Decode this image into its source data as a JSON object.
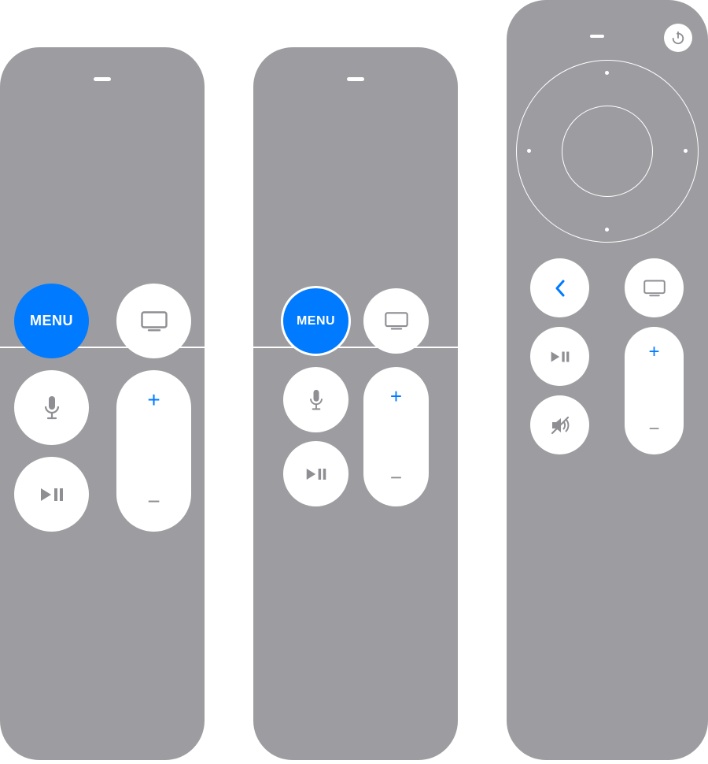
{
  "colors": {
    "accent": "#007aff",
    "remote_body": "#9d9da1",
    "button_face": "#ffffff",
    "icon_gray": "#8e8e93"
  },
  "remotes": [
    {
      "id": "siri-remote-gen1",
      "menu_label": "MENU",
      "menu_highlighted": true,
      "menu_style": "filled-blue",
      "buttons": [
        "menu",
        "tv",
        "mic",
        "play-pause",
        "volume-up",
        "volume-down"
      ],
      "touch_surface": "glass-top"
    },
    {
      "id": "siri-remote-gen1-alt",
      "menu_label": "MENU",
      "menu_highlighted": true,
      "menu_style": "blue-with-white-ring",
      "buttons": [
        "menu",
        "tv",
        "mic",
        "play-pause",
        "volume-up",
        "volume-down"
      ],
      "touch_surface": "glass-top"
    },
    {
      "id": "siri-remote-gen2",
      "menu_label": "",
      "menu_highlighted": false,
      "buttons": [
        "power",
        "clickpad",
        "back",
        "tv",
        "play-pause",
        "mute",
        "volume-up",
        "volume-down"
      ],
      "touch_surface": "clickpad"
    }
  ],
  "volume": {
    "plus": "+",
    "minus": "−"
  },
  "icons": {
    "tv": "tv-icon",
    "mic": "mic-icon",
    "play_pause": "play-pause-icon",
    "power": "power-icon",
    "back": "chevron-left-icon",
    "mute": "speaker-slash-icon"
  }
}
